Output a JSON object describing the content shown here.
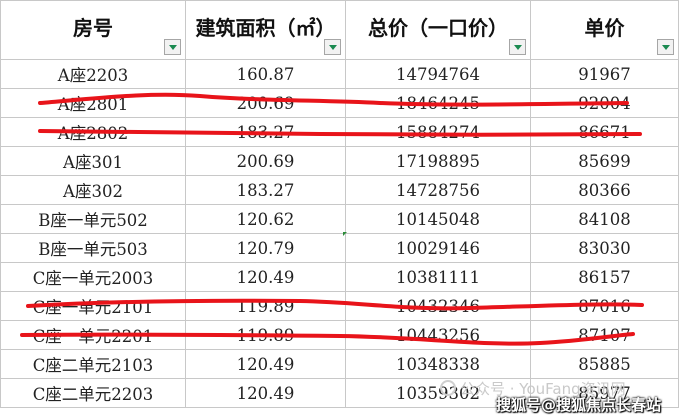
{
  "headers": [
    "房号",
    "建筑面积（㎡）",
    "总价（一口价）",
    "单价"
  ],
  "rows": [
    [
      "A座2203",
      "160.87",
      "14794764",
      "91967"
    ],
    [
      "A座2801",
      "200.69",
      "18464245",
      "92004"
    ],
    [
      "A座2802",
      "183.27",
      "15884274",
      "86671"
    ],
    [
      "A座301",
      "200.69",
      "17198895",
      "85699"
    ],
    [
      "A座302",
      "183.27",
      "14728756",
      "80366"
    ],
    [
      "B座一单元502",
      "120.62",
      "10145048",
      "84108"
    ],
    [
      "B座一单元503",
      "120.79",
      "10029146",
      "83030"
    ],
    [
      "C座一单元2003",
      "120.49",
      "10381111",
      "86157"
    ],
    [
      "C座一单元2101",
      "119.89",
      "10432346",
      "87016"
    ],
    [
      "C座一单元2201",
      "119.89",
      "10443256",
      "87107"
    ],
    [
      "C座二单元2103",
      "120.49",
      "10348338",
      "85885"
    ],
    [
      "C座二单元2203",
      "120.49",
      "10359302",
      "85977"
    ]
  ],
  "struck_rows": [
    1,
    2,
    8,
    9
  ],
  "strike_color": "#e8141a",
  "filter_arrow_color": "#1a8a50",
  "watermark": "公众号 · YouFang资讯网",
  "credit": "搜狐号@搜狐焦点长春站"
}
